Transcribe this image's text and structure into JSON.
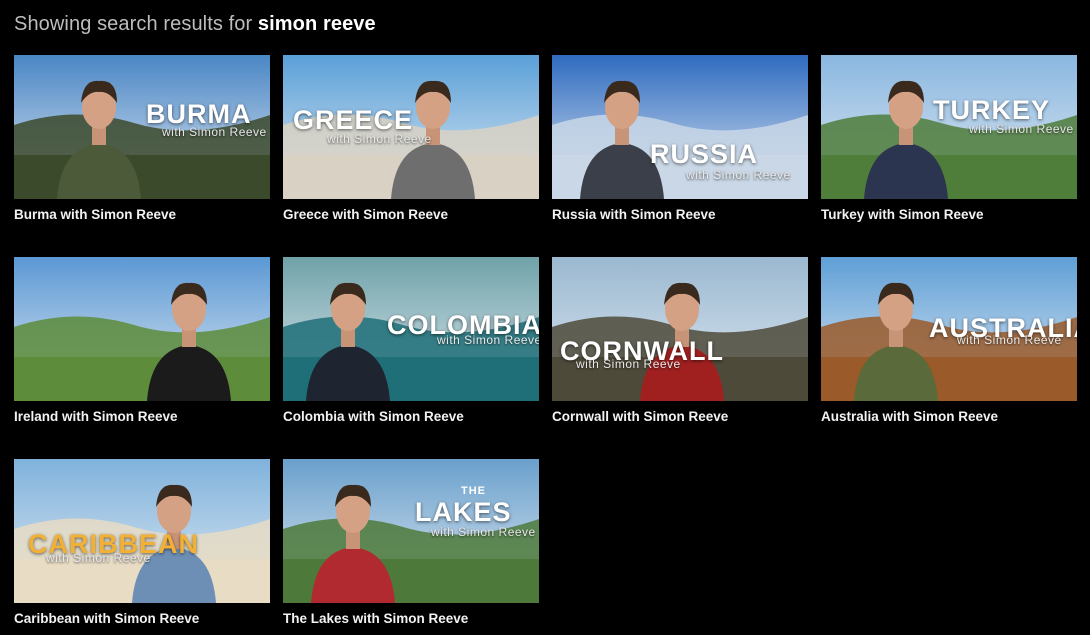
{
  "header": {
    "prefix": "Showing search results for ",
    "query": "simon reeve"
  },
  "results": [
    {
      "caption": "Burma with Simon Reeve",
      "overlay_title": "BURMA",
      "overlay_sub": "with Simon Reeve",
      "sky": "#4a86c5",
      "ground": "#3c4a2c",
      "shirt": "#4d5a3a"
    },
    {
      "caption": "Greece with Simon Reeve",
      "overlay_title": "GREECE",
      "overlay_sub": "with Simon Reeve",
      "sky": "#5aa0d8",
      "ground": "#d9d2c4",
      "shirt": "#6e6e6e"
    },
    {
      "caption": "Russia with Simon Reeve",
      "overlay_title": "RUSSIA",
      "overlay_sub": "with Simon Reeve",
      "sky": "#2f6bc0",
      "ground": "#c9d7e6",
      "shirt": "#3a3f4a"
    },
    {
      "caption": "Turkey with Simon Reeve",
      "overlay_title": "TURKEY",
      "overlay_sub": "with Simon Reeve",
      "sky": "#8ab7e0",
      "ground": "#4f7d3a",
      "shirt": "#2b3550"
    },
    {
      "caption": "Ireland with Simon Reeve",
      "overlay_title": "",
      "overlay_sub": "",
      "sky": "#5b98d4",
      "ground": "#5d8c3a",
      "shirt": "#1b1b1b"
    },
    {
      "caption": "Colombia with Simon Reeve",
      "overlay_title": "COLOMBIA",
      "overlay_sub": "with Simon Reeve",
      "sky": "#6fa2a8",
      "ground": "#1f6f78",
      "shirt": "#1e2430"
    },
    {
      "caption": "Cornwall with Simon Reeve",
      "overlay_title": "CORNWALL",
      "overlay_sub": "with Simon Reeve",
      "sky": "#9ab8d0",
      "ground": "#4e4a3a",
      "shirt": "#a02020"
    },
    {
      "caption": "Australia with Simon Reeve",
      "overlay_title": "AUSTRALIA",
      "overlay_sub": "with Simon Reeve",
      "sky": "#5f9fd6",
      "ground": "#9a5a2a",
      "shirt": "#5a6a3a"
    },
    {
      "caption": "Caribbean with Simon Reeve",
      "overlay_title": "CARIBBEAN",
      "overlay_sub": "with Simon Reeve",
      "sky": "#7fb2dc",
      "ground": "#e8dcc4",
      "shirt": "#6d8fb5"
    },
    {
      "caption": "The Lakes with Simon Reeve",
      "overlay_title": "LAKES",
      "overlay_pre": "THE",
      "overlay_sub": "with Simon Reeve",
      "sky": "#6aa0cc",
      "ground": "#4d7a3a",
      "shirt": "#b02a30"
    }
  ]
}
